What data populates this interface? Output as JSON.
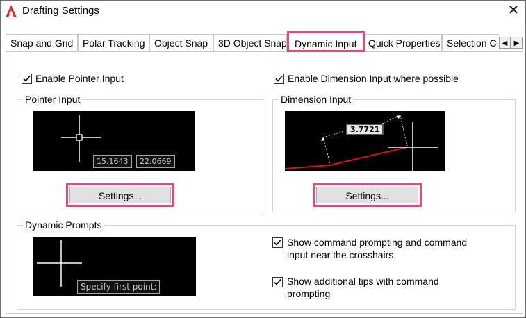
{
  "window": {
    "title": "Drafting Settings",
    "close_glyph": "✕",
    "icon": "autocad-icon",
    "accent_color": "#e8467c"
  },
  "tabs": [
    {
      "label": "Snap and Grid"
    },
    {
      "label": "Polar Tracking"
    },
    {
      "label": "Object Snap"
    },
    {
      "label": "3D Object Snap"
    },
    {
      "label": "Dynamic Input",
      "active": true
    },
    {
      "label": "Quick Properties"
    },
    {
      "label": "Selection C"
    }
  ],
  "tab_scroll": {
    "left": "◀",
    "right": "▶"
  },
  "pointer": {
    "enable_label": "Enable Pointer Input",
    "enabled": true,
    "group_title": "Pointer Input",
    "coord_x": "15.1643",
    "coord_y": "22.0669",
    "settings_label": "Settings..."
  },
  "dimension": {
    "enable_label": "Enable Dimension Input where possible",
    "enabled": true,
    "group_title": "Dimension Input",
    "value": "3.7721",
    "settings_label": "Settings..."
  },
  "prompts": {
    "group_title": "Dynamic Prompts",
    "prompt_text": "Specify first point:",
    "show_command_label": "Show command prompting and command input near the crosshairs",
    "show_command_checked": true,
    "show_tips_label": "Show additional tips with command prompting",
    "show_tips_checked": true
  }
}
